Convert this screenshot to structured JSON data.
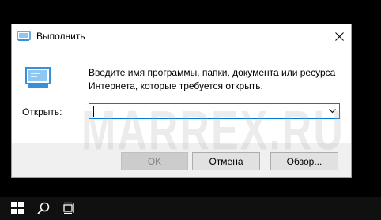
{
  "dialog": {
    "title": "Выполнить",
    "description": "Введите имя программы, папки, документа или ресурса Интернета, которые требуется открыть.",
    "open_label": "Открыть:",
    "input_value": "",
    "buttons": {
      "ok": "OK",
      "cancel": "Отмена",
      "browse": "Обзор..."
    }
  },
  "watermark": "MARREX.RU",
  "icons": {
    "title": "run-icon",
    "close": "close-icon",
    "large": "run-icon",
    "dropdown": "chevron-down-icon",
    "start": "windows-start-icon",
    "search": "search-icon",
    "taskview": "task-view-icon"
  },
  "colors": {
    "focus_border": "#0078d7",
    "icon_blue": "#3a8fd6",
    "taskbar": "#101010"
  }
}
